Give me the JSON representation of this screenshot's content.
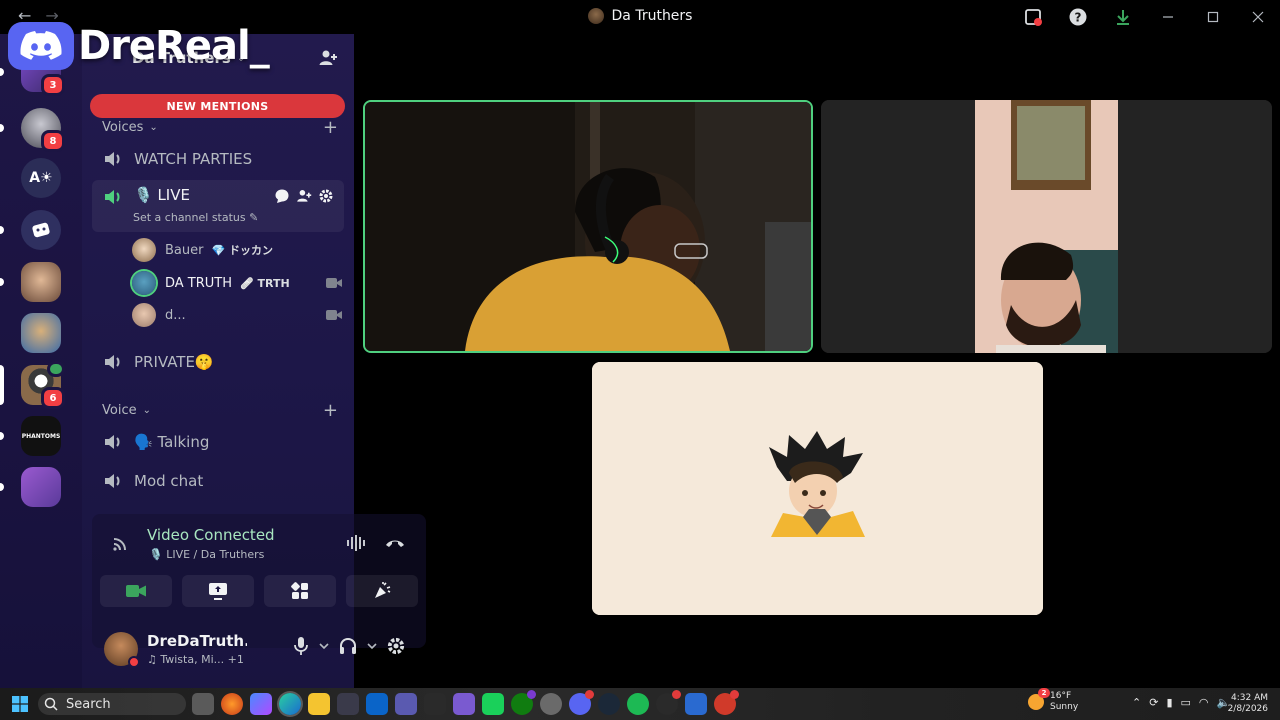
{
  "window": {
    "title": "Da Truthers",
    "back": "←",
    "forward": "→"
  },
  "overlay": {
    "name": "DreReal_"
  },
  "rail": {
    "servers": [
      {
        "name": "server-1",
        "badge": "3",
        "color": "#6a3ea8"
      },
      {
        "name": "server-2",
        "badge": "8",
        "color": "#5d5d68"
      },
      {
        "name": "server-3",
        "label": "A☀",
        "color": "#2b2d57"
      },
      {
        "name": "server-4",
        "color": "#2f3060"
      },
      {
        "name": "server-5",
        "color": "#a06a4a"
      },
      {
        "name": "server-6",
        "color": "#3a6aa8"
      },
      {
        "name": "server-7",
        "badge": "6",
        "color": "#6a5a4a",
        "active": true
      },
      {
        "name": "server-8",
        "label": "PHANTOMS",
        "color": "#111111"
      },
      {
        "name": "server-9",
        "color": "#7a4ab0"
      }
    ]
  },
  "server": {
    "name": "Da Truthers",
    "new_mentions": "NEW MENTIONS"
  },
  "categories": {
    "voices": "Voices",
    "voice": "Voice"
  },
  "channels": {
    "watch_parties": "WATCH PARTIES",
    "live": "🎙️ LIVE",
    "live_status": "Set a channel status",
    "private": "PRIVATE🤫",
    "talking": "🗣️ Talking",
    "mod_chat": "Mod chat"
  },
  "voice_users": [
    {
      "name": "Bauer",
      "tag": "💎 ドッカン",
      "color": "#8a6a4a",
      "camera": false,
      "strong": false
    },
    {
      "name": "DA TRUTH",
      "tag": "🩹 TRTH",
      "color": "#3a6a8a",
      "camera": true,
      "strong": true
    },
    {
      "name": "d...",
      "tag": "",
      "color": "#9a7a6a",
      "camera": true,
      "strong": false
    }
  ],
  "voice_connection": {
    "title": "Video Connected",
    "subtitle": "🎙️ LIVE / Da Truthers"
  },
  "user": {
    "name": "DreDaTruth...",
    "status": "♫ Twista, Mi...",
    "extra": "+1"
  },
  "taskbar": {
    "search": "Search",
    "weather_temp": "16°F",
    "weather_desc": "Sunny",
    "weather_badge": "2",
    "time": "4:32 AM",
    "date": "2/8/2026"
  },
  "colors": {
    "accent": "#5865f2",
    "speaking": "#4fd07f",
    "danger": "#da373c"
  }
}
